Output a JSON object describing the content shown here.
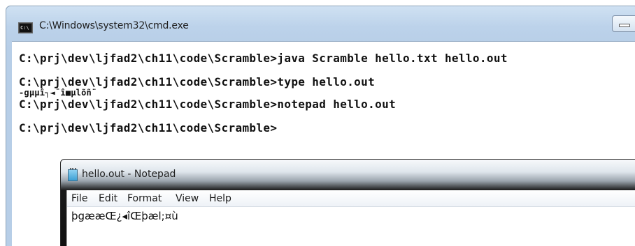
{
  "cmd": {
    "title": "C:\\Windows\\system32\\cmd.exe",
    "icon_text": "C:\\",
    "lines": [
      "C:\\prj\\dev\\ljfad2\\ch11\\code\\Scramble>java Scramble hello.txt hello.out",
      "C:\\prj\\dev\\ljfad2\\ch11\\code\\Scramble>type hello.out",
      "-gµµî┐◄¯î■µlõñ¨",
      "C:\\prj\\dev\\ljfad2\\ch11\\code\\Scramble>notepad hello.out",
      "C:\\prj\\dev\\ljfad2\\ch11\\code\\Scramble>"
    ]
  },
  "notepad": {
    "title": "hello.out - Notepad",
    "menu": [
      "File",
      "Edit",
      "Format",
      "View",
      "Help"
    ],
    "content": "þgææŒ¿◂îŒþæl;¤ù"
  },
  "colors": {
    "console_bg": "#ffffff",
    "console_text": "#111111",
    "window_frame": "#b7cee7",
    "notepad_frame": "#111111"
  }
}
